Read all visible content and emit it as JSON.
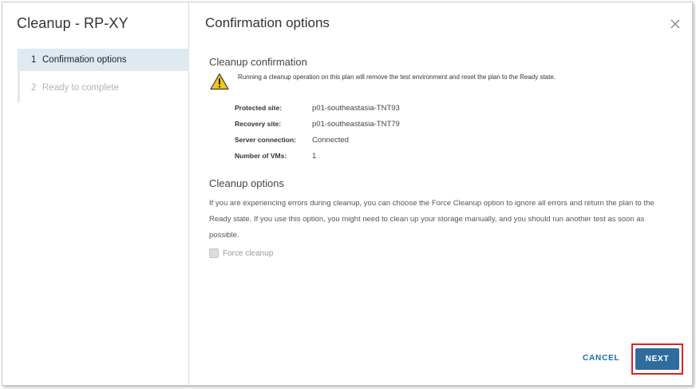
{
  "wizard": {
    "title": "Cleanup - RP-XY",
    "steps": [
      {
        "number": "1",
        "label": "Confirmation options",
        "state": "active"
      },
      {
        "number": "2",
        "label": "Ready to complete",
        "state": "inactive"
      }
    ]
  },
  "page": {
    "title": "Confirmation options",
    "close_icon": "close-icon"
  },
  "confirmation": {
    "heading": "Cleanup confirmation",
    "warning_icon": "warning-icon",
    "warning_text": "Running a cleanup operation on this plan will remove the test environment and reset the plan to the Ready state.",
    "properties": [
      {
        "label": "Protected site:",
        "value": "p01-southeastasia-TNT93"
      },
      {
        "label": "Recovery site:",
        "value": "p01-southeastasia-TNT79"
      },
      {
        "label": "Server connection:",
        "value": "Connected"
      },
      {
        "label": "Number of VMs:",
        "value": "1"
      }
    ]
  },
  "options": {
    "heading": "Cleanup options",
    "description": "If you are experiencing errors during cleanup, you can choose the Force Cleanup option to ignore all errors and return the plan to the Ready state. If you use this option, you might need to clean up your storage manually, and you should run another test as soon as possible.",
    "force_cleanup_label": "Force cleanup",
    "force_cleanup_checked": false
  },
  "footer": {
    "cancel_label": "CANCEL",
    "next_label": "NEXT"
  },
  "colors": {
    "accent": "#2e6c9d",
    "active_step_bg": "#dfe9f1",
    "highlight": "#e02020",
    "warning": "#f5c518"
  }
}
